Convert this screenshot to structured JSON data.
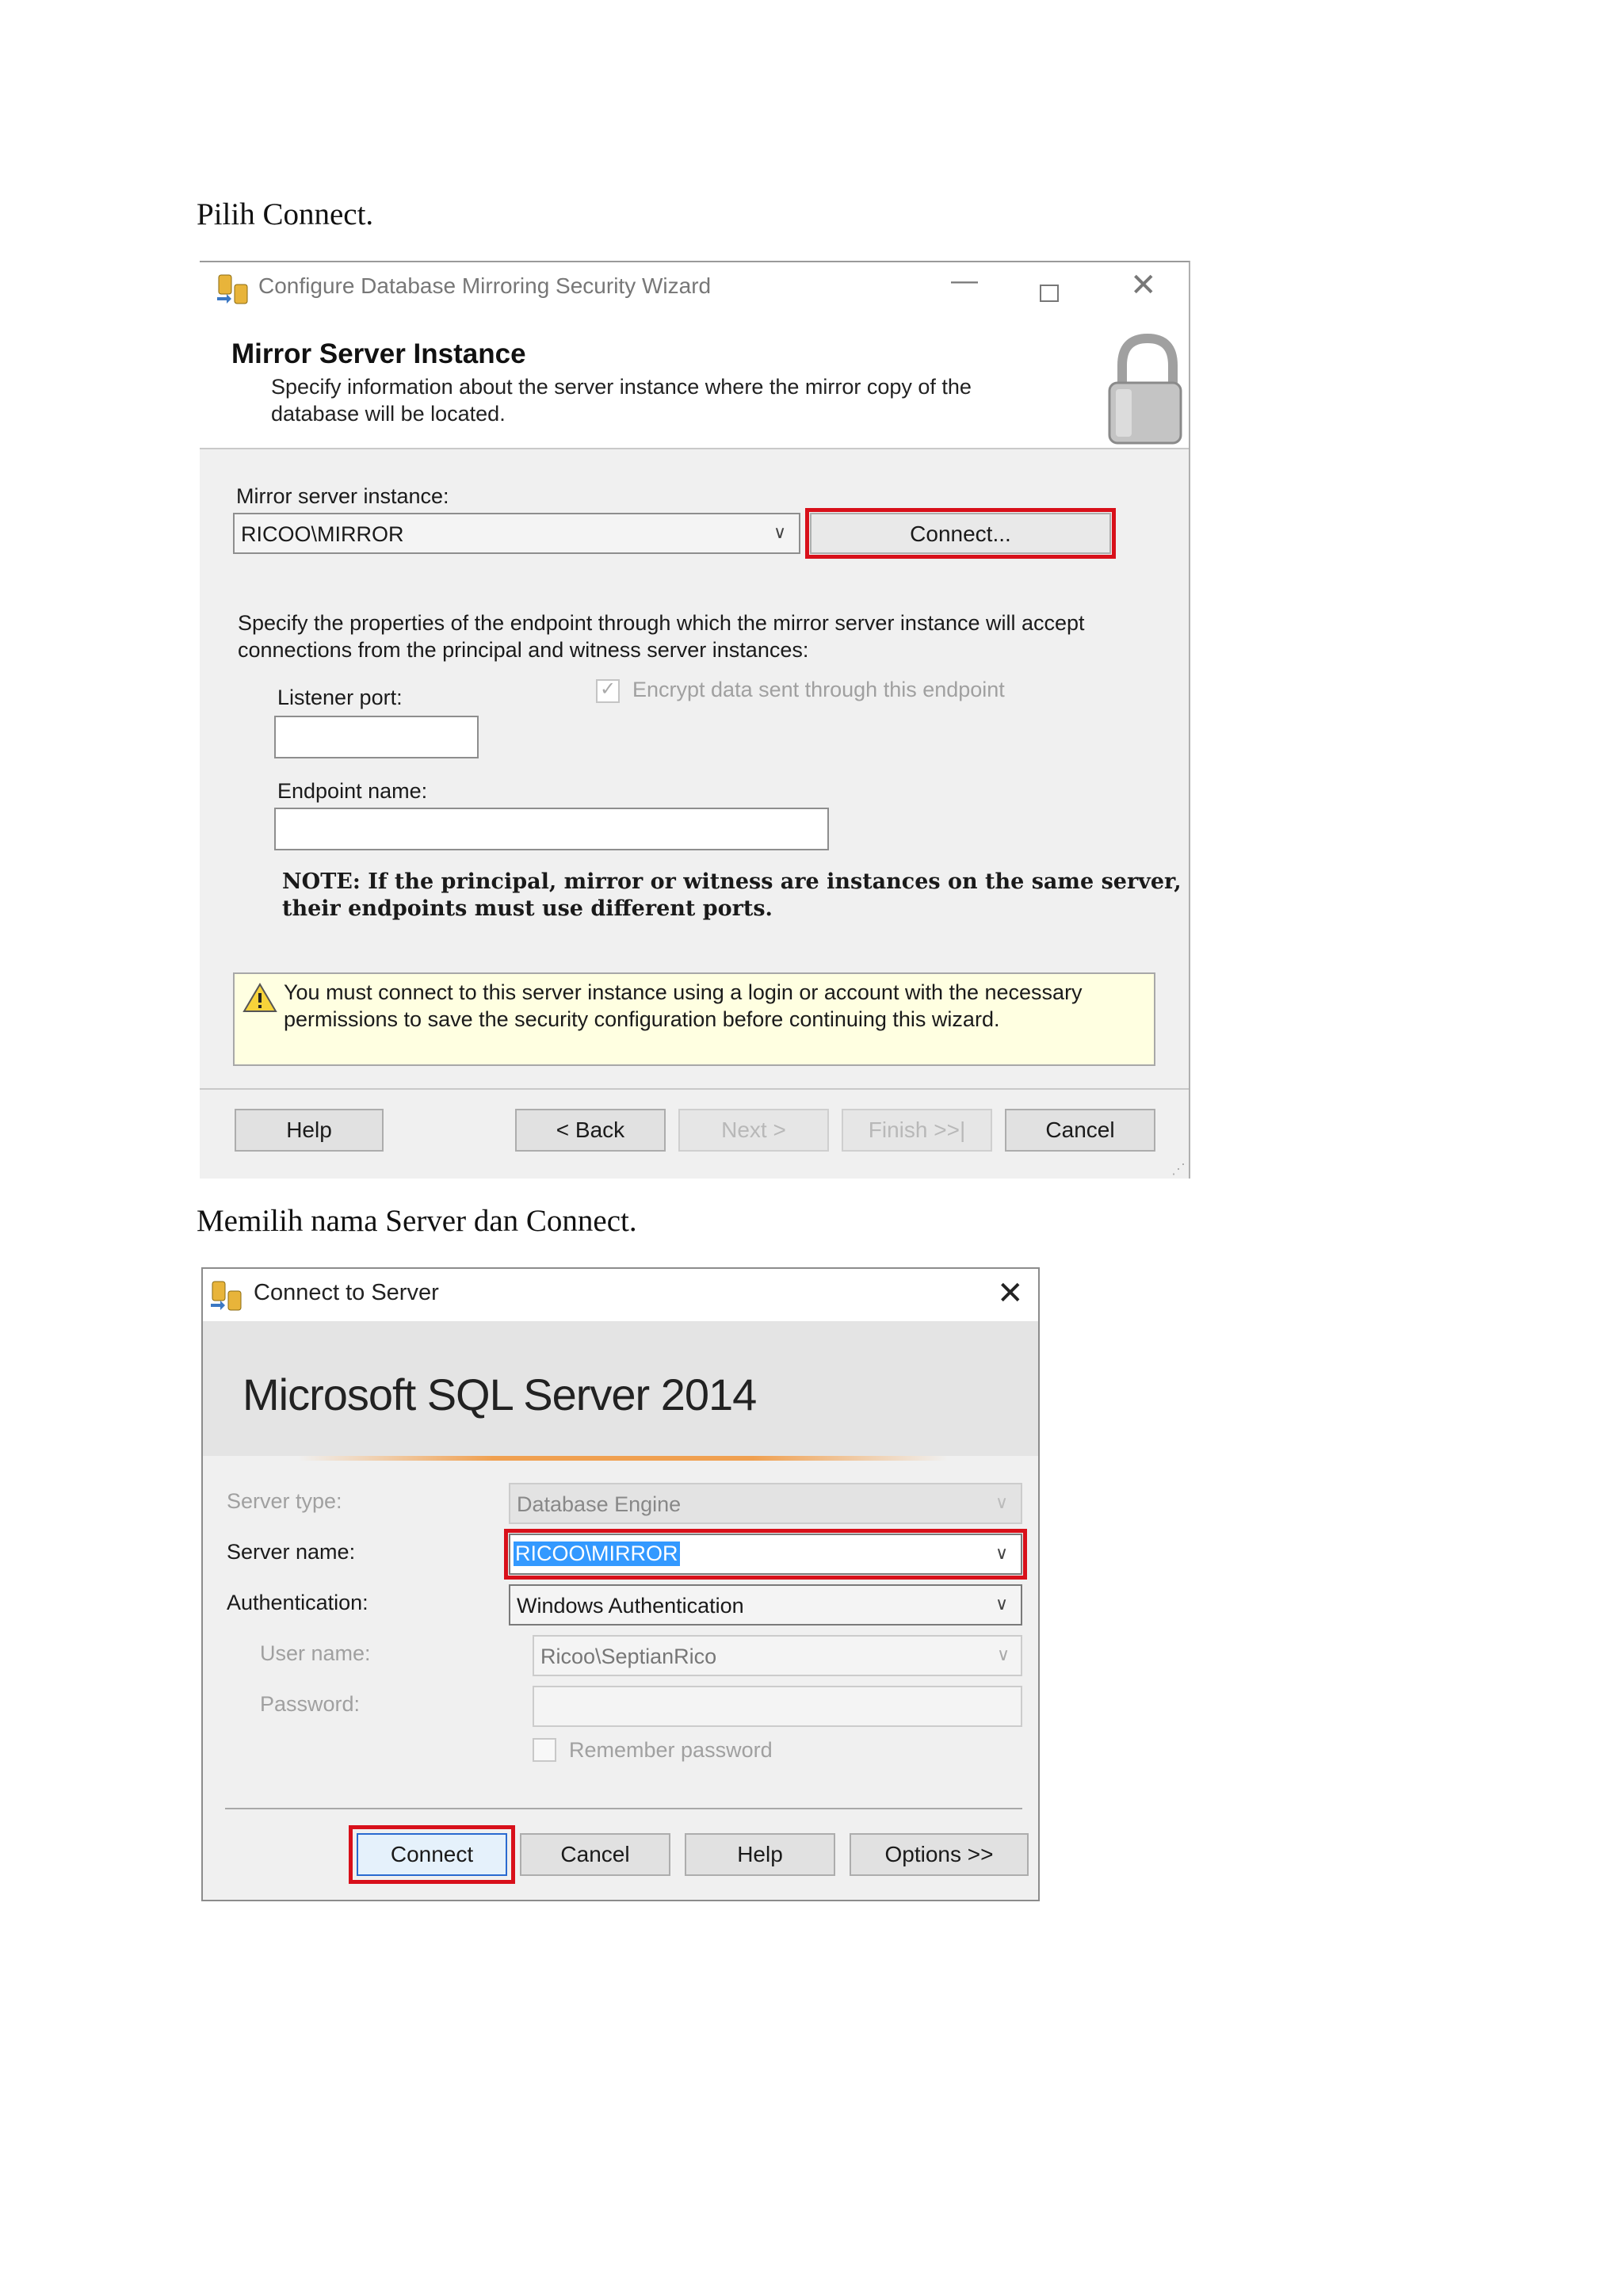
{
  "captions": {
    "first": "Pilih Connect.",
    "second": "Memilih nama Server dan Connect."
  },
  "wizard": {
    "title": "Configure Database Mirroring Security Wizard",
    "heading": "Mirror Server Instance",
    "subheading_line1": "Specify information about the server instance where the mirror copy of the",
    "subheading_line2": "database will be located.",
    "mirror_label": "Mirror server instance:",
    "mirror_value": "RICOO\\MIRROR",
    "connect_label": "Connect...",
    "desc_line1": "Specify the properties of the endpoint through which the mirror server instance will accept",
    "desc_line2": "connections from the principal and witness server instances:",
    "listener_label": "Listener port:",
    "encrypt_label": "Encrypt data sent through this endpoint",
    "endpoint_label": "Endpoint name:",
    "note_line1": "NOTE: If the principal, mirror or witness are instances on the same server,",
    "note_line2": "their endpoints must use different ports.",
    "warning_line1": "You must connect to this server instance using a login or account with the necessary",
    "warning_line2": "permissions to save the security configuration before continuing this wizard.",
    "buttons": {
      "help": "Help",
      "back": "< Back",
      "next": "Next >",
      "finish": "Finish >>|",
      "cancel": "Cancel"
    }
  },
  "connect": {
    "title": "Connect to Server",
    "product": "Microsoft SQL Server 2014",
    "server_type_label": "Server type:",
    "server_type_value": "Database Engine",
    "server_name_label": "Server name:",
    "server_name_value": "RICOO\\MIRROR",
    "auth_label": "Authentication:",
    "auth_value": "Windows Authentication",
    "user_label": "User name:",
    "user_value": "Ricoo\\SeptianRico",
    "password_label": "Password:",
    "remember_label": "Remember password",
    "buttons": {
      "connect": "Connect",
      "cancel": "Cancel",
      "help": "Help",
      "options": "Options >>"
    }
  },
  "colors": {
    "highlight_red": "#d8101a",
    "selection_blue": "#3399ff",
    "orange_accent": "#f0a050",
    "warning_bg": "#ffffe1"
  }
}
